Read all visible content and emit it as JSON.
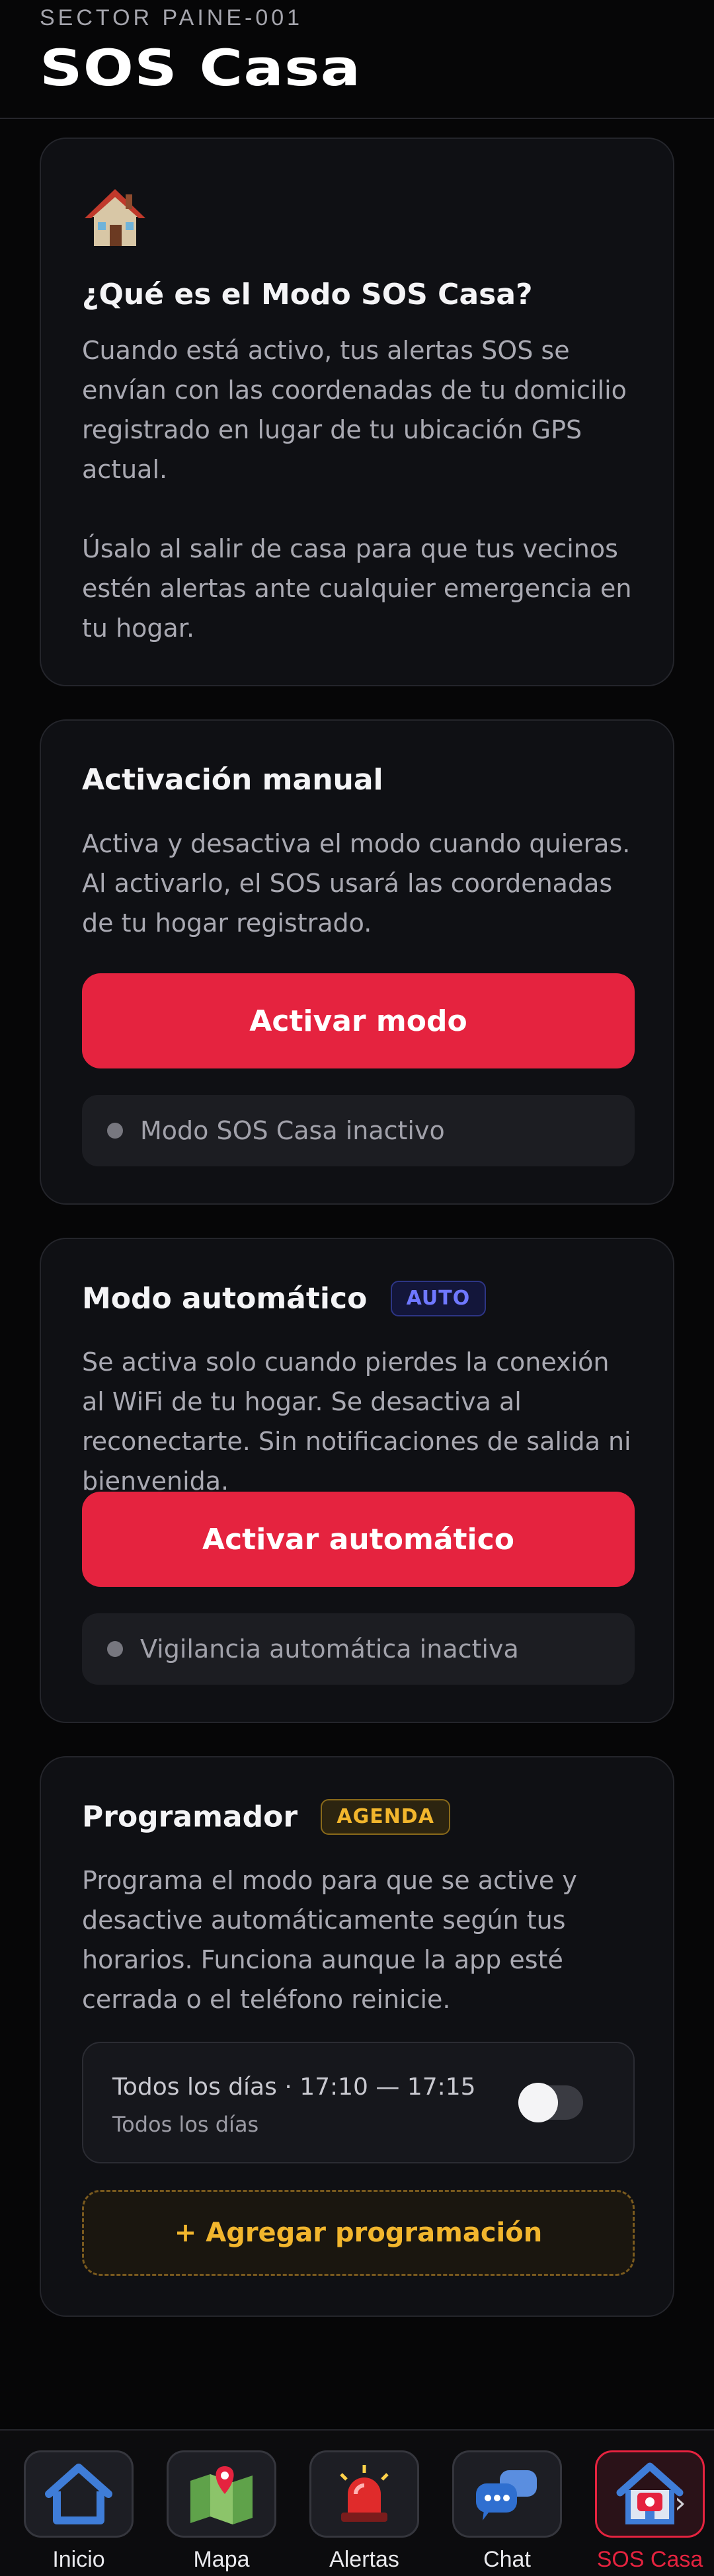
{
  "header": {
    "sector": "SECTOR PAINE-001",
    "title": "SOS Casa"
  },
  "intro_card": {
    "icon": "house-icon",
    "title": "¿Qué es el Modo SOS Casa?",
    "paragraph1": "Cuando está activo, tus alertas SOS se envían con las coordenadas de tu domicilio registrado en lugar de tu ubicación GPS actual.",
    "paragraph2": "Úsalo al salir de casa para que tus vecinos estén alertas ante cualquier emergencia en tu hogar."
  },
  "manual_card": {
    "title": "Activación manual",
    "description": "Activa y desactiva el modo cuando quieras. Al activarlo, el SOS usará las coordenadas de tu hogar registrado.",
    "button_label": "Activar modo",
    "status": "Modo SOS Casa inactivo"
  },
  "auto_card": {
    "title": "Modo automático",
    "badge": "AUTO",
    "description": "Se activa solo cuando pierdes la conexión al WiFi de tu hogar. Se desactiva al reconectarte. Sin notificaciones de salida ni bienvenida.",
    "button_label": "Activar automático",
    "status": "Vigilancia automática inactiva"
  },
  "scheduler_card": {
    "title": "Programador",
    "badge": "AGENDA",
    "description": "Programa el modo para que se active y desactive automáticamente según tus horarios. Funciona aunque la app esté cerrada o el teléfono reinicie.",
    "schedule": {
      "title": "Todos los días · 17:10 — 17:15",
      "subtitle": "Todos los días",
      "enabled": false
    },
    "add_button": "+ Agregar programación"
  },
  "bottom_nav": {
    "items": [
      {
        "label": "Inicio",
        "icon": "home-icon"
      },
      {
        "label": "Mapa",
        "icon": "map-icon"
      },
      {
        "label": "Alertas",
        "icon": "siren-icon"
      },
      {
        "label": "Chat",
        "icon": "chat-icon"
      },
      {
        "label": "SOS Casa",
        "icon": "sos-house-icon",
        "active": true
      }
    ]
  },
  "colors": {
    "accent_red": "#e5233f",
    "badge_blue": "#6f78ff",
    "badge_amber": "#f2b62d"
  }
}
